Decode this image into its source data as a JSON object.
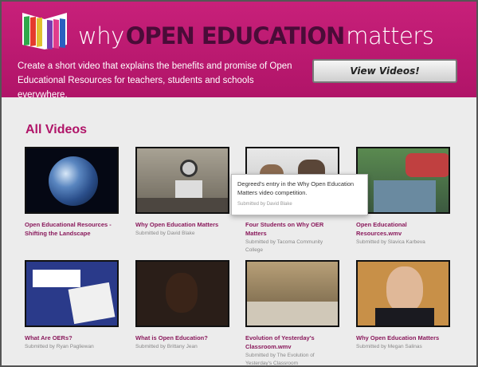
{
  "header": {
    "brand_why": "why",
    "brand_oe": "OPEN EDUCATION",
    "brand_matters": "matters",
    "tagline": "Create a short video that explains the benefits and promise of Open Educational Resources for teachers, students and schools everywhere.",
    "view_button": "View Videos!"
  },
  "main": {
    "section_title": "All Videos",
    "submitted_by_label": "Submitted by",
    "videos": [
      {
        "title": "Open Educational Resources - Shifting the Landscape",
        "submitter": ""
      },
      {
        "title": "Why Open Education Matters",
        "submitter": "David Blake"
      },
      {
        "title": "Four Students on Why OER Matters",
        "submitter": "Tacoma Community College"
      },
      {
        "title": "Open Educational Resources.wmv",
        "submitter": "Slavica Karbeva"
      },
      {
        "title": "What Are OERs?",
        "submitter": "Ryan Pagliewan"
      },
      {
        "title": "What is Open Education?",
        "submitter": "Brittany Jean"
      },
      {
        "title": "Evolution of Yesterday's Classroom.wmv",
        "submitter": "The Evolution of Yesterday's Classroom"
      },
      {
        "title": "Why Open Education Matters",
        "submitter": "Megan Salinas"
      }
    ]
  },
  "tooltip": {
    "text": "Degreed's entry in the Why Open Education Matters video competition.",
    "submitter": "David Blake"
  },
  "colors": {
    "brand": "#b01468",
    "title": "#8a1a5c"
  }
}
